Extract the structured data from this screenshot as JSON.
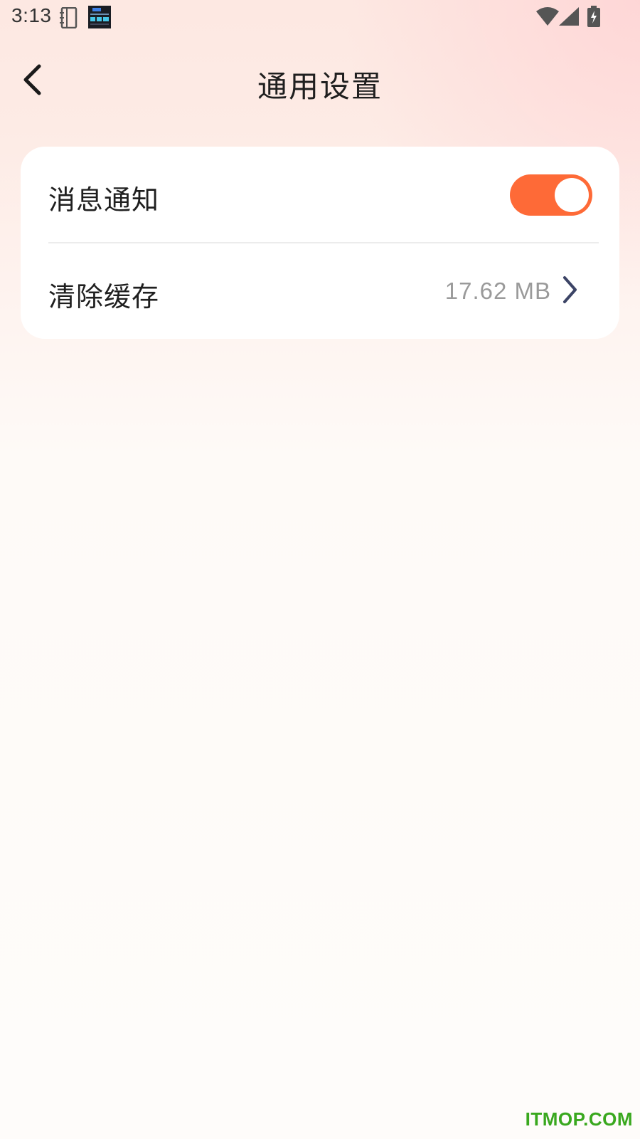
{
  "status_bar": {
    "time": "3:13",
    "icons": [
      "notebook-icon",
      "clock-widget-icon",
      "wifi-icon",
      "signal-icon",
      "battery-charging-icon"
    ]
  },
  "header": {
    "title": "通用设置",
    "back_icon": "chevron-left-icon"
  },
  "settings": {
    "notification": {
      "label": "消息通知",
      "toggle_on": true
    },
    "clear_cache": {
      "label": "清除缓存",
      "value": "17.62 MB",
      "icon": "chevron-right-icon"
    }
  },
  "watermark": "ITMOP.COM",
  "colors": {
    "accent": "#fe6a37",
    "chevron": "#3c4466",
    "watermark": "#39a81e"
  }
}
